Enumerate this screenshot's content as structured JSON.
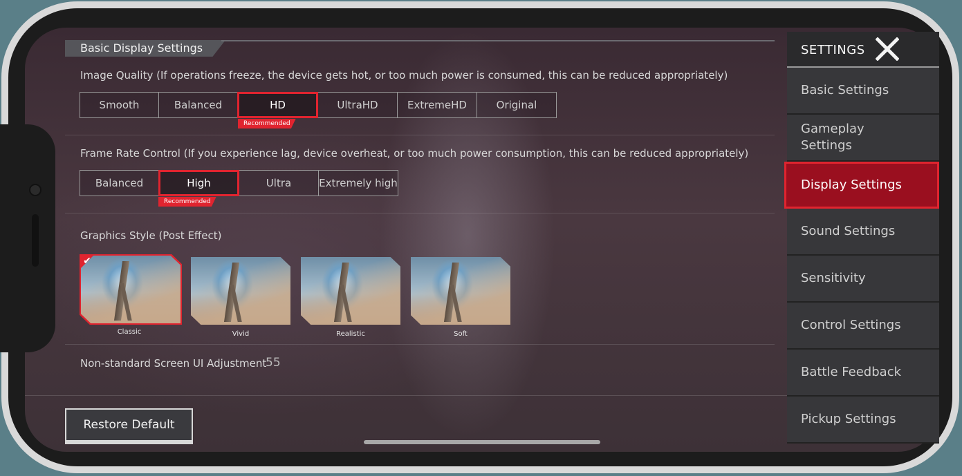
{
  "section": {
    "title": "Basic Display Settings"
  },
  "image_quality": {
    "label": "Image Quality (If operations freeze, the device gets hot, or too much power is consumed, this can be reduced appropriately)",
    "options": [
      "Smooth",
      "Balanced",
      "HD",
      "UltraHD",
      "ExtremeHD",
      "Original"
    ],
    "selected": "HD",
    "recommended_label": "Recommended"
  },
  "frame_rate": {
    "label": "Frame Rate Control (If you experience lag, device overheat, or too much power consumption, this can be reduced appropriately)",
    "options": [
      "Balanced",
      "High",
      "Ultra",
      "Extremely high"
    ],
    "selected": "High",
    "recommended_label": "Recommended"
  },
  "graphics_style": {
    "label": "Graphics Style (Post Effect)",
    "options": [
      "Classic",
      "Vivid",
      "Realistic",
      "Soft"
    ],
    "selected": "Classic"
  },
  "screen_adjust": {
    "label": "Non-standard Screen UI Adjustment",
    "value": "55"
  },
  "restore_label": "Restore Default",
  "sidebar": {
    "title": "SETTINGS",
    "items": [
      {
        "label": "Basic Settings"
      },
      {
        "label": "Gameplay Settings"
      },
      {
        "label": "Display Settings",
        "active": true
      },
      {
        "label": "Sound Settings"
      },
      {
        "label": "Sensitivity"
      },
      {
        "label": "Control Settings"
      },
      {
        "label": "Battle Feedback"
      },
      {
        "label": "Pickup Settings"
      }
    ]
  },
  "colors": {
    "accent": "#e0242f",
    "active_bg": "#9a0f1f",
    "panel": "#37373a"
  },
  "icons": {
    "close": "close-icon",
    "check": "checkmark-icon"
  }
}
